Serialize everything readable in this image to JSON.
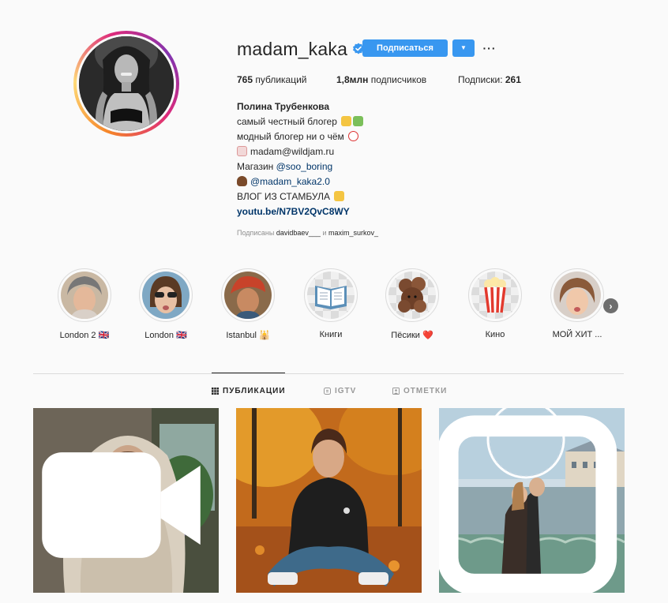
{
  "profile": {
    "username": "madam_kaka",
    "verified": true,
    "follow_label": "Подписаться",
    "more_label": "···",
    "stats": {
      "posts_count": "765",
      "posts_label": " публикаций",
      "followers_count": "1,8млн",
      "followers_label": " подписчиков",
      "following_label": "Подписки: ",
      "following_count": "261"
    },
    "bio": {
      "full_name": "Полина Трубенкова",
      "line1": "самый честный блогер",
      "line2": "модный блогер ни о чём",
      "line3": "madam@wildjam.ru",
      "line4_prefix": "Магазин ",
      "line4_link": "@soo_boring",
      "line5_link": "@madam_kaka2.0",
      "line6": "ВЛОГ ИЗ СТАМБУЛА",
      "website": "youtu.be/N7BV2QvC8WY"
    },
    "followed_by": {
      "prefix": "Подписаны ",
      "user1": "davidbaev___",
      "sep": " и ",
      "user2": "maxim_surkov_"
    }
  },
  "highlights": [
    {
      "label": "London 2 🇬🇧"
    },
    {
      "label": "London 🇬🇧"
    },
    {
      "label": "Istanbul 🕌"
    },
    {
      "label": "Книги"
    },
    {
      "label": "Пёсики ❤️"
    },
    {
      "label": "Кино"
    },
    {
      "label": "МОЙ ХИТ ..."
    }
  ],
  "tabs": {
    "posts": "ПУБЛИКАЦИИ",
    "igtv": "IGTV",
    "tagged": "ОТМЕТКИ"
  },
  "colors": {
    "accent": "#3897f0",
    "link": "#003569",
    "text": "#262626",
    "muted": "#8e8e8e",
    "border": "#dbdbdb"
  },
  "icons": {
    "verified": "verified-badge-icon",
    "dropdown": "chevron-down-icon",
    "more": "more-horizontal-icon",
    "next": "chevron-right-icon",
    "posts_tab": "grid-icon",
    "igtv_tab": "igtv-icon",
    "tagged_tab": "tag-icon"
  }
}
